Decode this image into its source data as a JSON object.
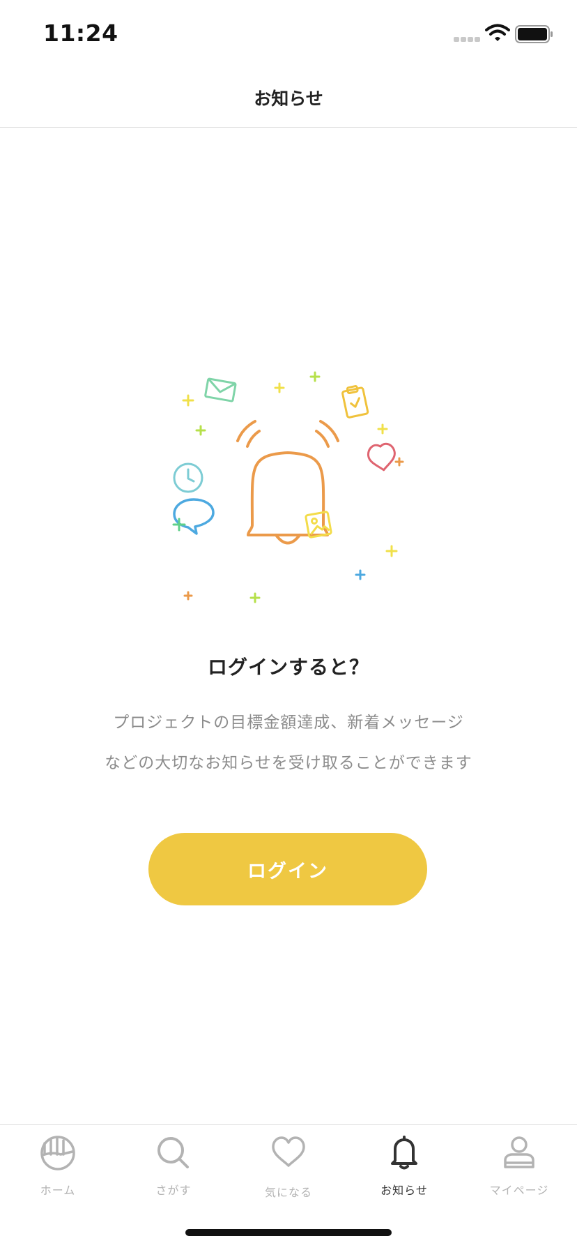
{
  "status_bar": {
    "time": "11:24"
  },
  "header": {
    "title": "お知らせ"
  },
  "content": {
    "headline": "ログインすると？",
    "description_line1": "プロジェクトの目標金額達成、新着メッセージ",
    "description_line2": "などの大切なお知らせを受け取ることができます",
    "login_label": "ログイン"
  },
  "tabs": [
    {
      "label": "ホーム",
      "icon": "home-icon",
      "active": false
    },
    {
      "label": "さがす",
      "icon": "search-icon",
      "active": false
    },
    {
      "label": "気になる",
      "icon": "heart-icon",
      "active": false
    },
    {
      "label": "お知らせ",
      "icon": "bell-icon",
      "active": true
    },
    {
      "label": "マイページ",
      "icon": "person-icon",
      "active": false
    }
  ],
  "colors": {
    "accent": "#efc842",
    "bell": "#eb9a4a",
    "tab_inactive": "#b3b3b3",
    "tab_active": "#333333"
  }
}
